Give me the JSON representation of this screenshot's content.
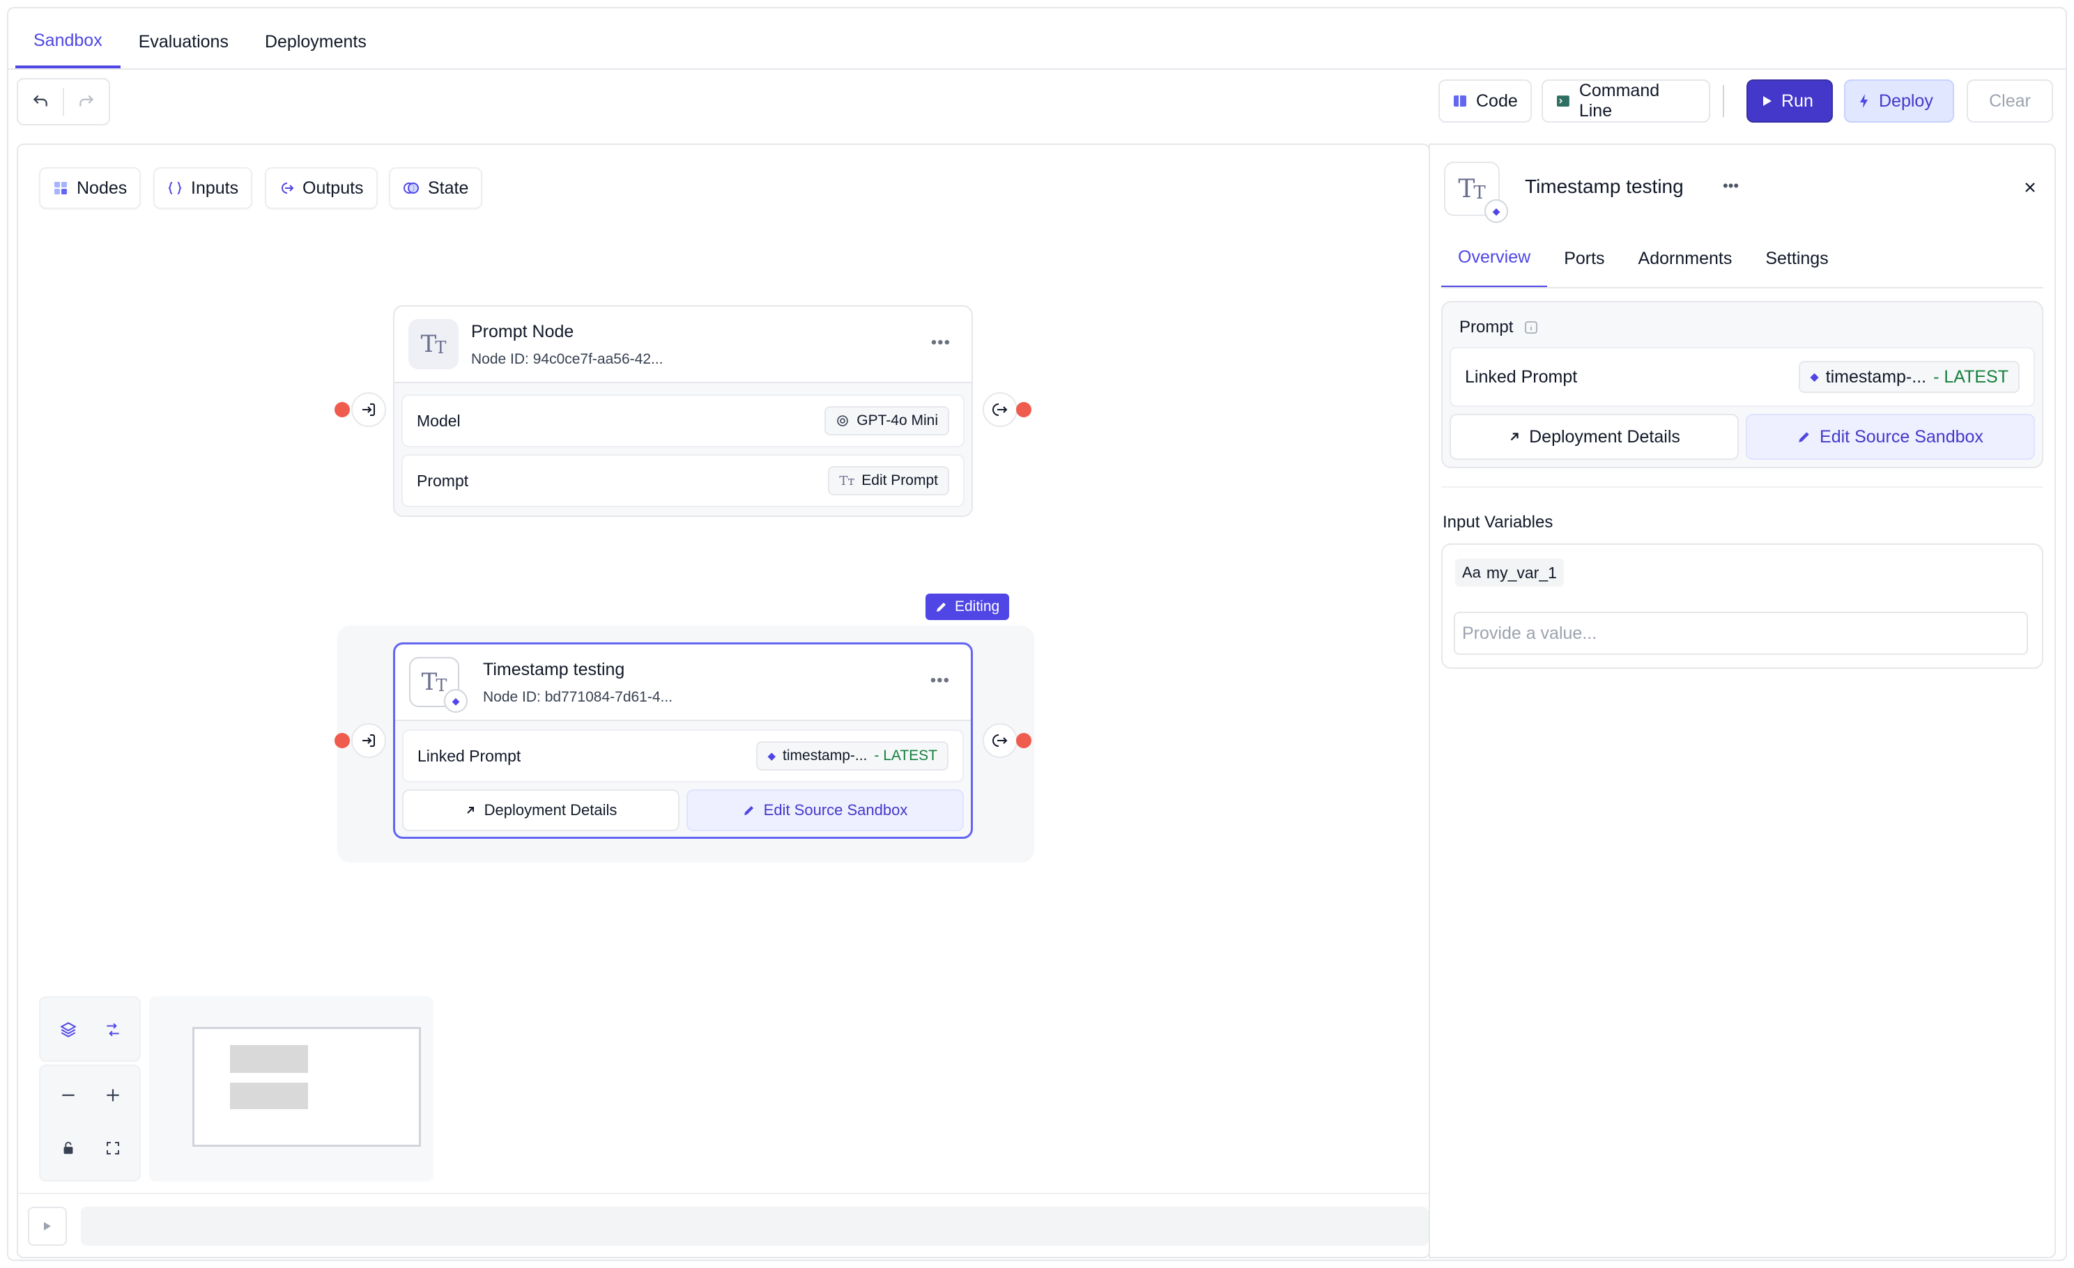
{
  "top_tabs": [
    "Sandbox",
    "Evaluations",
    "Deployments"
  ],
  "toolbar": {
    "code": "Code",
    "command_line": "Command Line",
    "run": "Run",
    "deploy": "Deploy",
    "clear": "Clear"
  },
  "canvas_pills": {
    "nodes": "Nodes",
    "inputs": "Inputs",
    "outputs": "Outputs",
    "state": "State"
  },
  "prompt_node": {
    "title": "Prompt Node",
    "node_id": "Node ID:  94c0ce7f-aa56-42...",
    "model_label": "Model",
    "model_value": "GPT-4o Mini",
    "prompt_label": "Prompt",
    "edit_prompt": "Edit Prompt"
  },
  "editing_tag": "Editing",
  "timestamp_node": {
    "title": "Timestamp testing",
    "node_id": "Node ID:  bd771084-7d61-4...",
    "linked_prompt_label": "Linked Prompt",
    "linked_prompt_value": "timestamp-...",
    "latest": "- LATEST",
    "deployment_details": "Deployment Details",
    "edit_source_sandbox": "Edit Source Sandbox"
  },
  "panel": {
    "title": "Timestamp testing",
    "tabs": [
      "Overview",
      "Ports",
      "Adornments",
      "Settings"
    ],
    "prompt_section": "Prompt",
    "linked_prompt_label": "Linked Prompt",
    "linked_prompt_value": "timestamp-...",
    "latest": "- LATEST",
    "deployment_details": "Deployment Details",
    "edit_source_sandbox": "Edit Source Sandbox",
    "input_variables": "Input Variables",
    "variable_type": "Aa",
    "variable_name": "my_var_1",
    "value_placeholder": "Provide a value..."
  },
  "colors": {
    "accent": "#4f46e5",
    "run_bg": "#4338ca",
    "port_dot": "#ef5b4c",
    "latest": "#15803d"
  }
}
